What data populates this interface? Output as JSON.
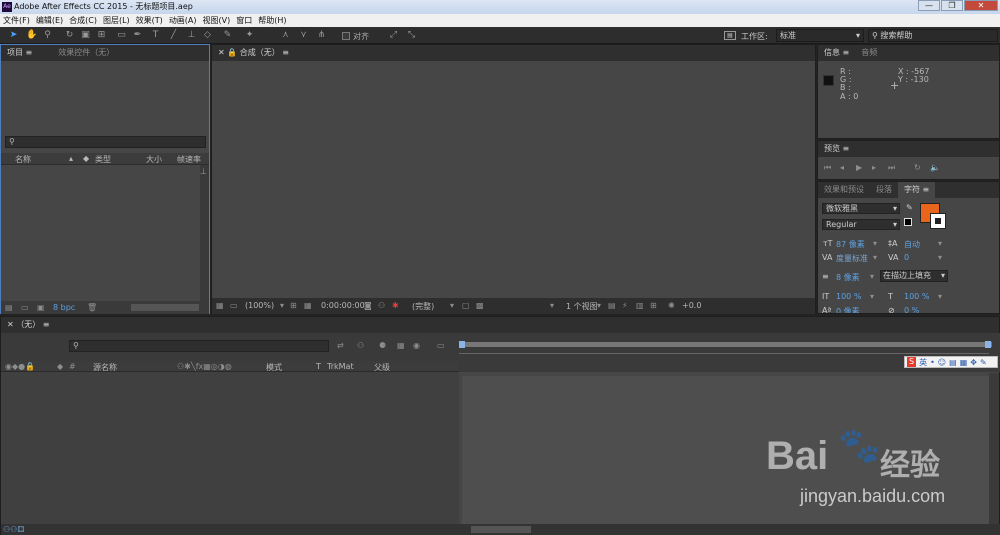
{
  "window": {
    "title": "Adobe After Effects CC 2015 - 无标题项目.aep",
    "app_icon": "Ae",
    "buttons": [
      "—",
      "❐",
      "✕"
    ]
  },
  "menu": [
    "文件(F)",
    "编辑(E)",
    "合成(C)",
    "图层(L)",
    "效果(T)",
    "动画(A)",
    "视图(V)",
    "窗口",
    "帮助(H)"
  ],
  "toolbar": {
    "snap_label": "对齐",
    "workspace_label": "工作区:",
    "workspace_value": "标准",
    "search_help": "搜索帮助"
  },
  "project_panel": {
    "tabs": [
      "项目",
      "效果控件（无）"
    ],
    "columns": [
      "名称",
      "类型",
      "大小",
      "帧速率"
    ],
    "bpc": "8 bpc"
  },
  "comp_panel": {
    "tab": "合成（无）",
    "zoom": "(100%)",
    "timecode": "0:00:00:00",
    "resolution": "(完整)",
    "views": "1 个视图",
    "exposure": "+0.0"
  },
  "info_panel": {
    "tabs": [
      "信息",
      "音频"
    ],
    "r": "R :",
    "g": "G :",
    "b": "B :",
    "a": "A : 0",
    "x": "X : -567",
    "y": "Y : -130"
  },
  "preview_panel": {
    "tab": "预览"
  },
  "character_panel": {
    "tabs": [
      "效果和预设",
      "段落",
      "字符"
    ],
    "font": "微软雅黑",
    "style": "Regular",
    "size": "87 像素",
    "leading": "自动",
    "kerning": "度量标准",
    "tracking": "0",
    "stroke": "8 像素",
    "stroke_mode": "在描边上填充",
    "vscale": "100 %",
    "hscale": "100 %",
    "baseline": "0 像素",
    "tsume": "0 %",
    "fill_color": "#e8651b"
  },
  "timeline": {
    "tab": "（无）",
    "columns": {
      "source": "源名称",
      "mode": "模式",
      "t": "T",
      "trkmat": "TrkMat",
      "parent": "父级"
    }
  },
  "ime": {
    "labels": [
      "S",
      "英"
    ]
  },
  "watermark": {
    "brand": "Bai",
    "brand2": "经验",
    "url": "jingyan.baidu.com"
  }
}
